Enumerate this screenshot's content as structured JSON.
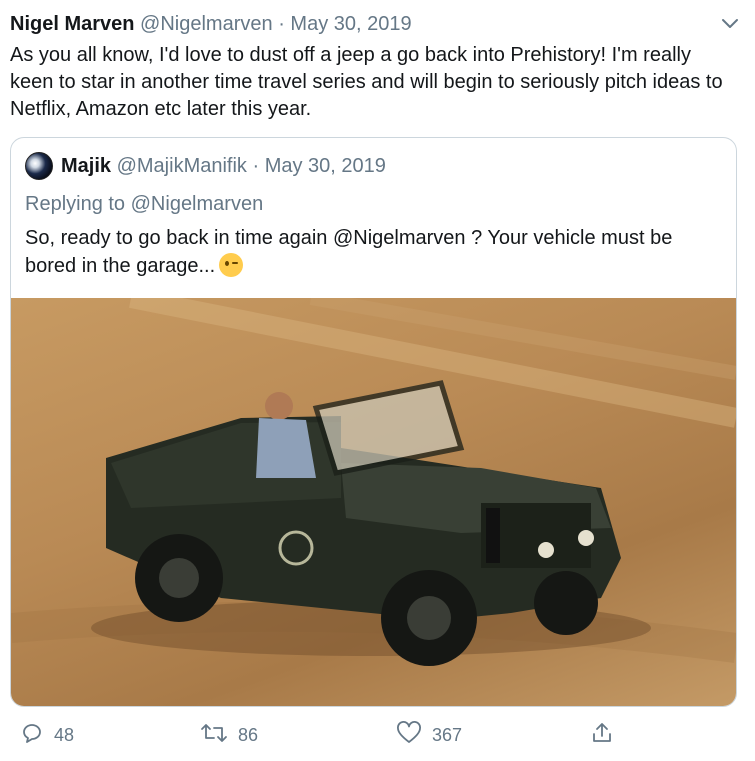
{
  "tweet": {
    "author_name": "Nigel Marven",
    "author_handle": "@Nigelmarven",
    "separator": "·",
    "date": "May 30, 2019",
    "text": "As you all know, I'd love to dust off a jeep a go back into Prehistory! I'm really keen to star in another time travel series and will begin to seriously pitch ideas to Netflix, Amazon etc later this year."
  },
  "quoted": {
    "author_name": "Majik",
    "author_handle": "@MajikManifik",
    "separator": "·",
    "date": "May 30, 2019",
    "replying_prefix": "Replying to",
    "replying_handle": "@Nigelmarven",
    "text": "So, ready to go back in time again @Nigelmarven ? Your vehicle must be bored in the garage...",
    "emoji": "winking-face"
  },
  "actions": {
    "reply_count": "48",
    "retweet_count": "86",
    "like_count": "367"
  },
  "colors": {
    "text": "#14171a",
    "muted": "#657786",
    "border": "#ccd6dd"
  },
  "icons": [
    "chevron-down-icon",
    "reply-icon",
    "retweet-icon",
    "like-icon",
    "share-icon"
  ]
}
